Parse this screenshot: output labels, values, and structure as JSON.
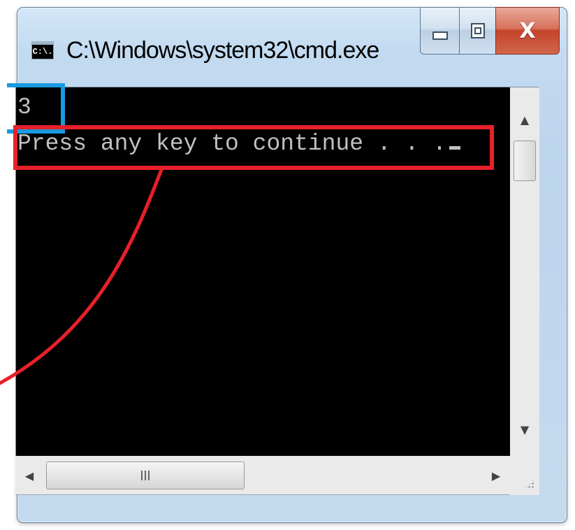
{
  "window": {
    "title": "C:\\Windows\\system32\\cmd.exe",
    "icon_label": "C:\\.",
    "icon": "cmd-app-icon",
    "caption_buttons": {
      "minimize_icon": "minimize-icon",
      "maximize_icon": "restore-icon",
      "close_icon": "close-icon",
      "close_glyph": "X"
    }
  },
  "console": {
    "lines": [
      "3",
      "Press any key to continue . . ."
    ],
    "text_color": "#c0c0c0",
    "background": "#000000"
  },
  "scrollbars": {
    "up_arrow": "▲",
    "down_arrow": "▼",
    "left_arrow": "◀",
    "right_arrow": "▶"
  },
  "annotations": {
    "highlight_value_color": "#1a9be0",
    "highlight_prompt_color": "#e8202a"
  }
}
